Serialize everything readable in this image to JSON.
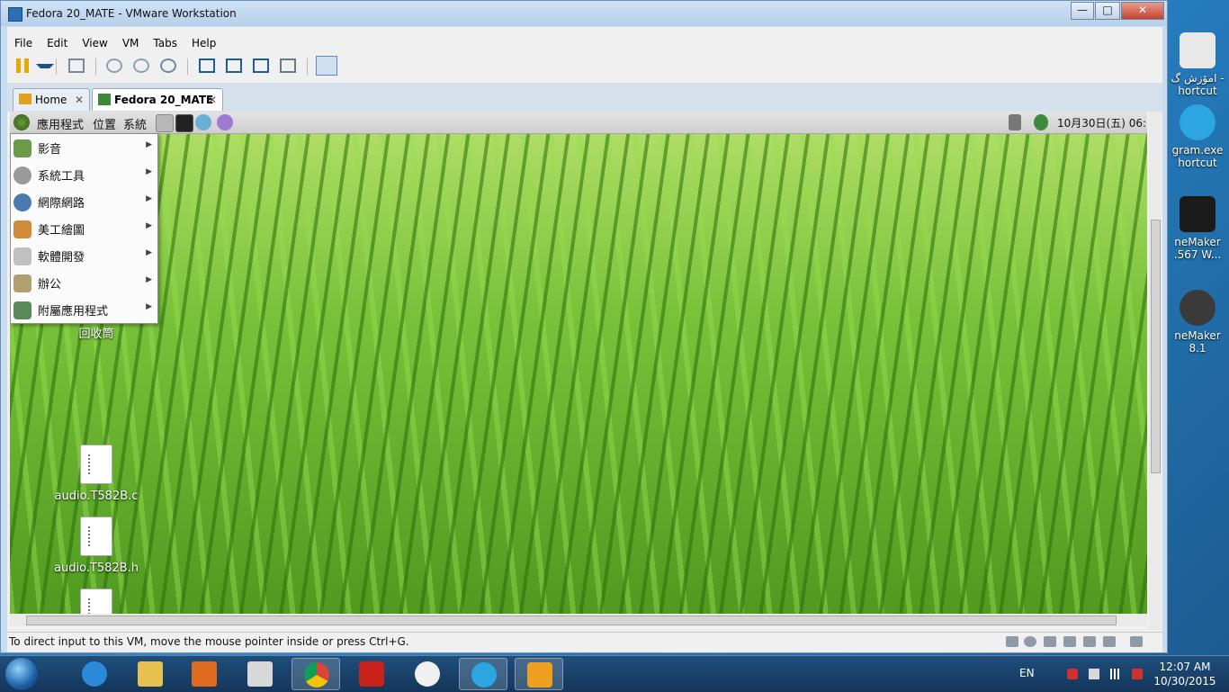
{
  "window": {
    "title": "Fedora 20_MATE - VMware Workstation",
    "controls": {
      "minimize": "—",
      "maximize": "□",
      "close": "✕"
    }
  },
  "menubar": [
    "File",
    "Edit",
    "View",
    "VM",
    "Tabs",
    "Help"
  ],
  "toolbar": [
    "pause-icon",
    "dropdown-icon",
    "send-ctrl-alt-del-icon",
    "snapshot-take-icon",
    "snapshot-revert-icon",
    "snapshot-manager-icon",
    "sidebar-icon",
    "console-icon",
    "fullscreen-icon",
    "unity-icon",
    "autofit-icon"
  ],
  "tabs": [
    {
      "label": "Home",
      "close": "✕",
      "active": false
    },
    {
      "label": "Fedora 20_MATE",
      "close": "✕",
      "active": true
    }
  ],
  "guest_panel": {
    "menus": [
      "應用程式",
      "位置",
      "系統"
    ],
    "clock": "10月30日(五) 06:"
  },
  "app_menu": [
    {
      "label": "影音",
      "icon": "multimedia-icon",
      "arrow": "▶"
    },
    {
      "label": "系統工具",
      "icon": "system-tools-icon",
      "arrow": "▶"
    },
    {
      "label": "網際網路",
      "icon": "internet-icon",
      "arrow": "▶"
    },
    {
      "label": "美工繪圖",
      "icon": "graphics-icon",
      "arrow": "▶"
    },
    {
      "label": "軟體開發",
      "icon": "development-icon",
      "arrow": "▶"
    },
    {
      "label": "辦公",
      "icon": "office-icon",
      "arrow": "▶"
    },
    {
      "label": "附屬應用程式",
      "icon": "accessories-icon",
      "arrow": "▶"
    }
  ],
  "guest_desktop": {
    "trash_label": "回收筒",
    "files": [
      "audio.T582B.c",
      "audio.T582B.h"
    ]
  },
  "statusbar": {
    "message": "To direct input to this VM, move the mouse pointer inside or press Ctrl+G."
  },
  "host_desktop": {
    "icons": [
      "امۆزش گ - hortcut",
      "gram.exe hortcut",
      "neMaker .567 W...",
      "neMaker 8.1"
    ]
  },
  "taskbar": {
    "language": "EN",
    "time": "12:07 AM",
    "date": "10/30/2015"
  },
  "colors": {
    "accent": "#2f6db1",
    "taskbar": "#1f4e7c",
    "grass": "#79c23a"
  }
}
